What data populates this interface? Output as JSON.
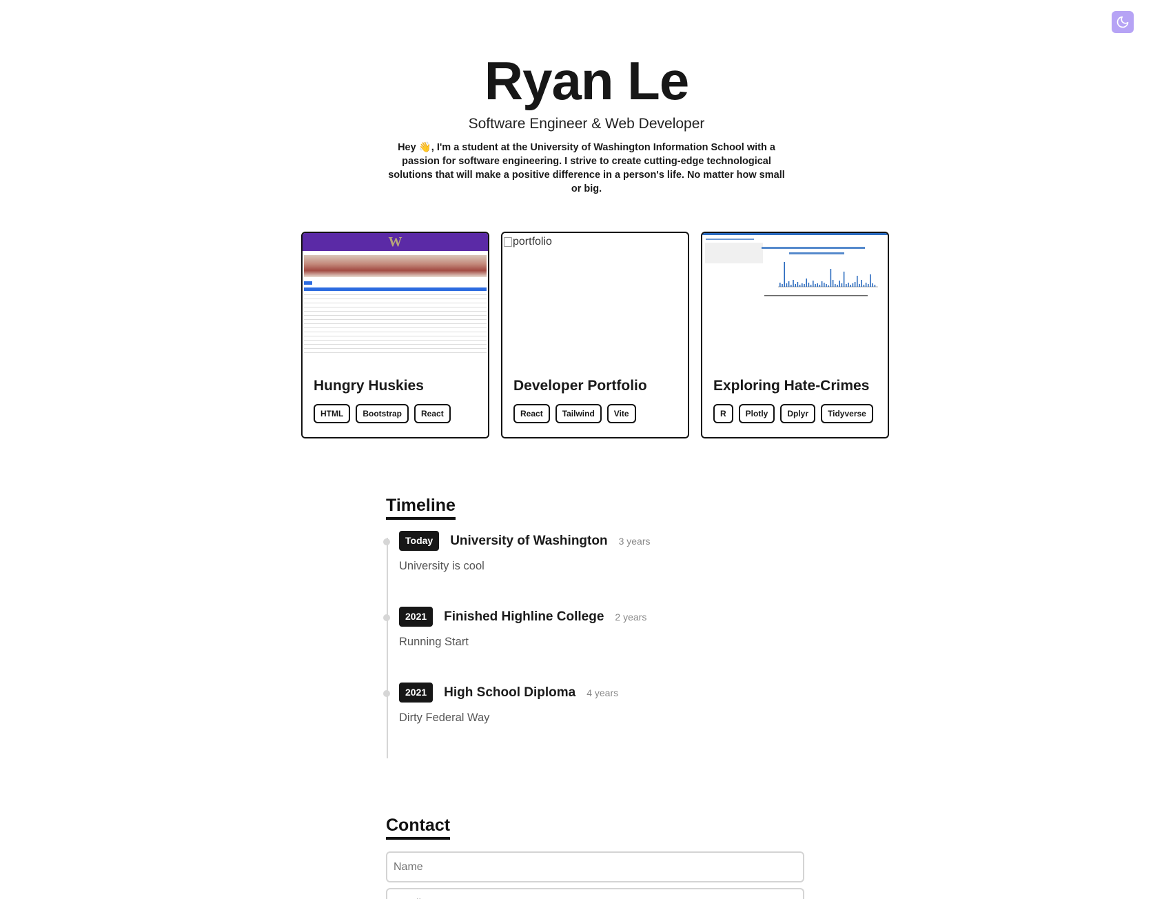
{
  "theme_toggle": {
    "icon": "moon-icon",
    "color": "#b6a3f5"
  },
  "hero": {
    "name": "Ryan Le",
    "subtitle": "Software Engineer & Web Developer",
    "bio": "Hey 👋, I'm a student at the University of Washington Information School with a passion for software engineering. I strive to create cutting-edge technological solutions that will make a positive difference in a person's life. No matter how small or big."
  },
  "projects": [
    {
      "title": "Hungry Huskies",
      "tags": [
        "HTML",
        "Bootstrap",
        "React"
      ]
    },
    {
      "title": "Developer Portfolio",
      "image_alt": "portfolio",
      "tags": [
        "React",
        "Tailwind",
        "Vite"
      ]
    },
    {
      "title": "Exploring Hate-Crimes",
      "tags": [
        "R",
        "Plotly",
        "Dplyr",
        "Tidyverse"
      ]
    }
  ],
  "timeline": {
    "title": "Timeline",
    "items": [
      {
        "badge": "Today",
        "title": "University of Washington",
        "duration": "3 years",
        "description": "University is cool"
      },
      {
        "badge": "2021",
        "title": "Finished Highline College",
        "duration": "2 years",
        "description": "Running Start"
      },
      {
        "badge": "2021",
        "title": "High School Diploma",
        "duration": "4 years",
        "description": "Dirty Federal Way"
      }
    ]
  },
  "contact": {
    "title": "Contact",
    "name_placeholder": "Name",
    "email_placeholder": "Email"
  }
}
